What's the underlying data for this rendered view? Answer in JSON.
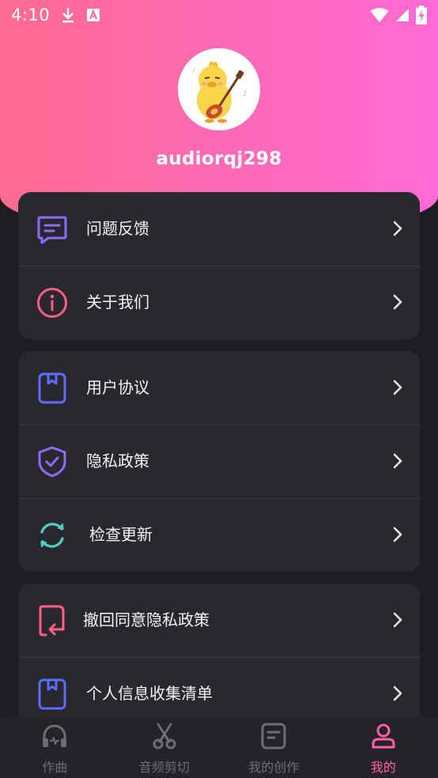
{
  "status_bar": {
    "time": "4:10",
    "icons": [
      "download-icon",
      "a-notification-icon",
      "wifi-icon",
      "signal-icon",
      "battery-charging-icon"
    ]
  },
  "profile": {
    "username": "audiorqj298",
    "avatar": "duck-guitar-avatar"
  },
  "menu_groups": [
    {
      "items": [
        {
          "label": "问题反馈",
          "icon": "feedback-icon",
          "color": "#8d6bff"
        },
        {
          "label": "关于我们",
          "icon": "info-icon",
          "color": "#ff5f86"
        }
      ]
    },
    {
      "items": [
        {
          "label": "用户协议",
          "icon": "bookmark-icon",
          "color": "#5b6cff"
        },
        {
          "label": "隐私政策",
          "icon": "shield-icon",
          "color": "#8d6bff"
        },
        {
          "label": "检查更新",
          "icon": "refresh-icon",
          "color": "#4fd1c5"
        }
      ]
    },
    {
      "items": [
        {
          "label": "撤回同意隐私政策",
          "icon": "revoke-icon",
          "color": "#ff5f86"
        },
        {
          "label": "个人信息收集清单",
          "icon": "bookmark-icon",
          "color": "#5b6cff"
        }
      ]
    }
  ],
  "bottom_nav": {
    "items": [
      {
        "label": "作曲",
        "icon": "headphones-icon",
        "active": false
      },
      {
        "label": "音频剪切",
        "icon": "scissors-icon",
        "active": false
      },
      {
        "label": "我的创作",
        "icon": "document-icon",
        "active": false
      },
      {
        "label": "我的",
        "icon": "person-icon",
        "active": true
      }
    ],
    "active_color": "#ff5fa8",
    "inactive_color": "#6d6c73"
  },
  "colors": {
    "header_gradient": [
      "#ff6b91",
      "#ff6ad6"
    ],
    "background": "#1e1d22",
    "card": "#29282e"
  }
}
